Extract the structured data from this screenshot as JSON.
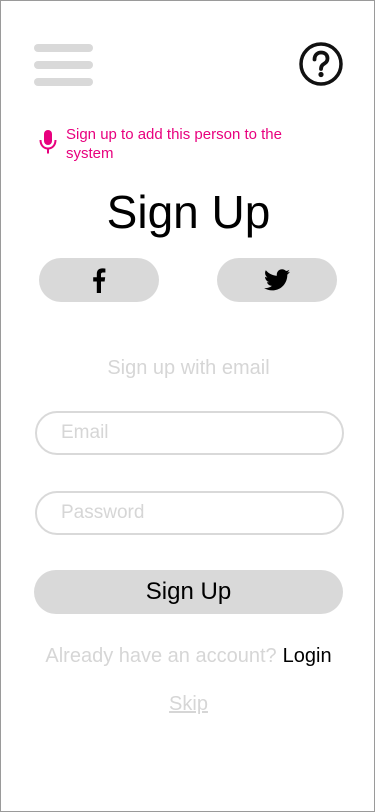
{
  "header": {
    "menu_icon": "hamburger-menu-icon",
    "help_icon": "question-circle-icon"
  },
  "voice_hint": {
    "icon": "microphone-icon",
    "text": "Sign up to add this person to the system",
    "color": "#e8007e"
  },
  "title": "Sign Up",
  "social": {
    "facebook_icon": "facebook-icon",
    "twitter_icon": "twitter-icon"
  },
  "email_caption": "Sign up with email",
  "form": {
    "email_placeholder": "Email",
    "email_value": "",
    "password_placeholder": "Password",
    "password_value": "",
    "submit_label": "Sign Up"
  },
  "login": {
    "prompt": "Already have an account?",
    "link_label": "Login"
  },
  "skip_label": "Skip",
  "colors": {
    "button_fill": "#d9d9d9",
    "muted_text": "#d6d6d6",
    "accent": "#e8007e"
  }
}
